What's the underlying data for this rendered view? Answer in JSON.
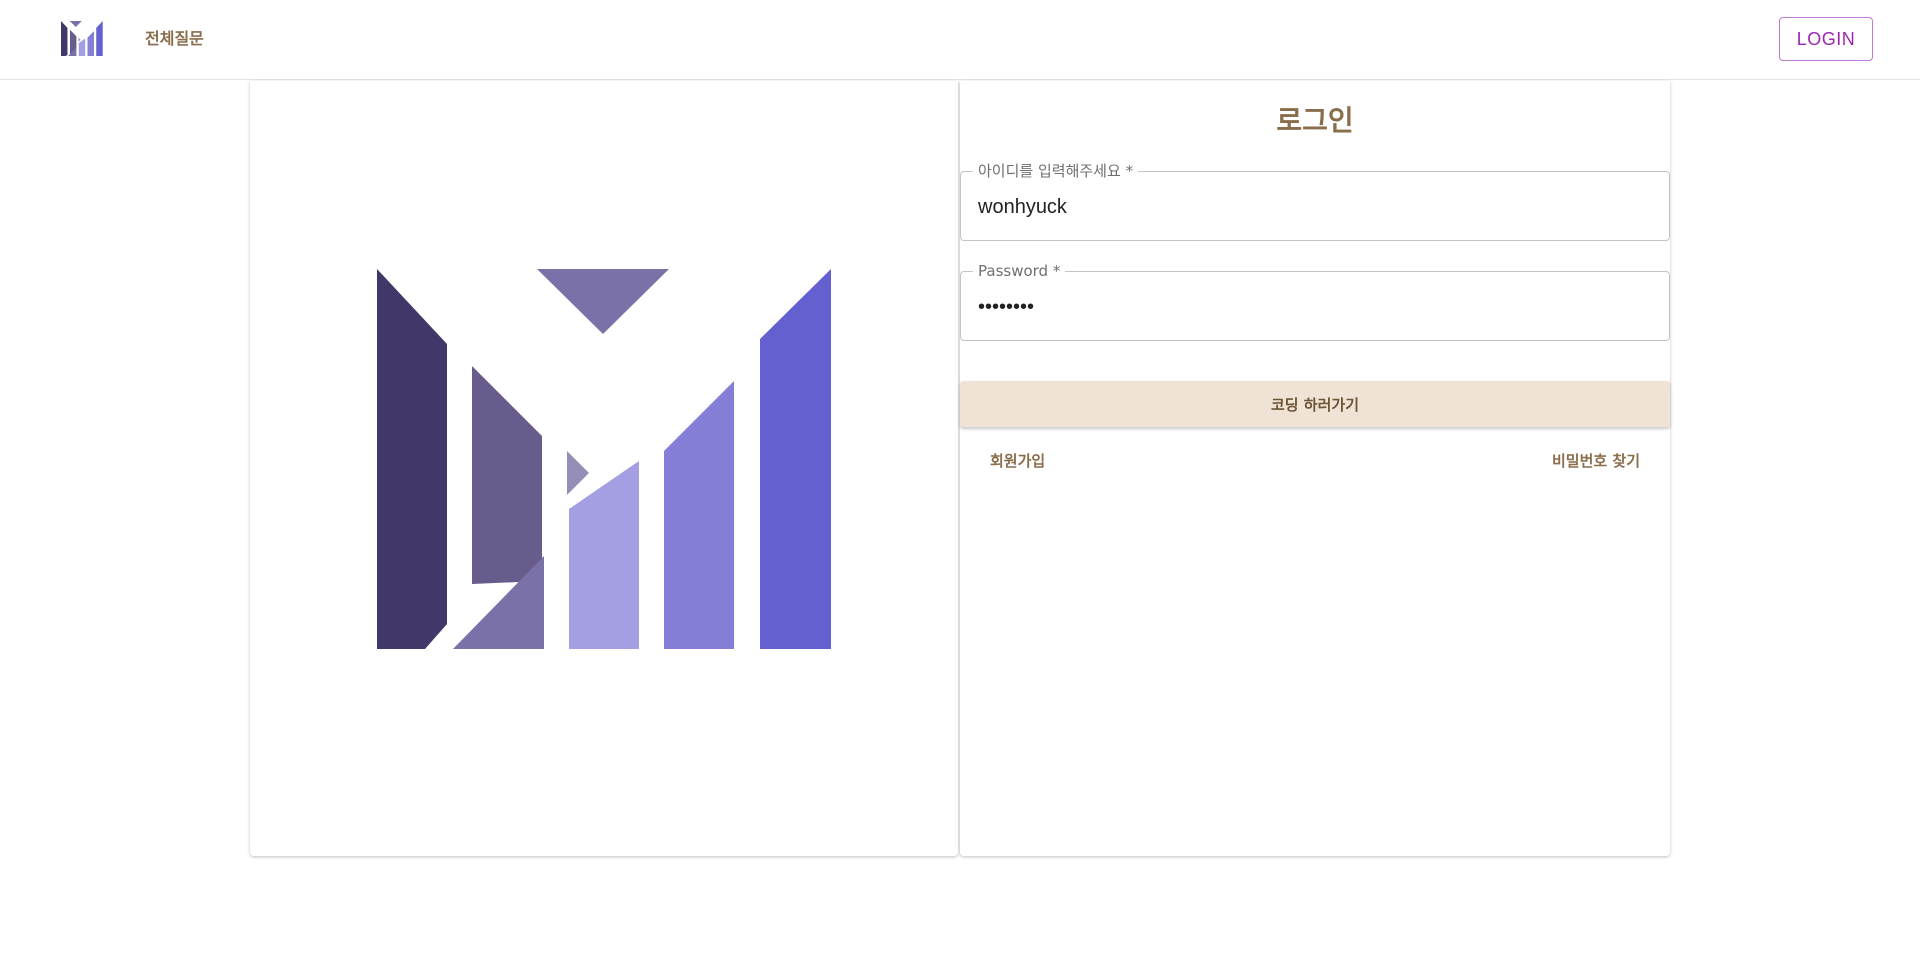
{
  "header": {
    "logo": "brand-logo",
    "nav_all_questions": "전체질문",
    "login_button": "LOGIN"
  },
  "hero": {
    "logo": "brand-logo-large"
  },
  "login_form": {
    "title": "로그인",
    "id_field": {
      "label": "아이디를 입력해주세요",
      "required_mark": "*",
      "value": "wonhyuck"
    },
    "password_field": {
      "label": "Password",
      "required_mark": "*",
      "value": "••••••••"
    },
    "submit_label": "코딩 하러가기",
    "signup_link": "회원가입",
    "find_password_link": "비밀번호 찾기"
  },
  "colors": {
    "brand_brown": "#8a6e4b",
    "login_purple": "#9c27b0",
    "submit_bg": "#f0e3d5",
    "logo_dark": "#413769",
    "logo_mid": "#675c8c",
    "logo_light": "#a39fe2",
    "logo_blue": "#6560cf"
  }
}
